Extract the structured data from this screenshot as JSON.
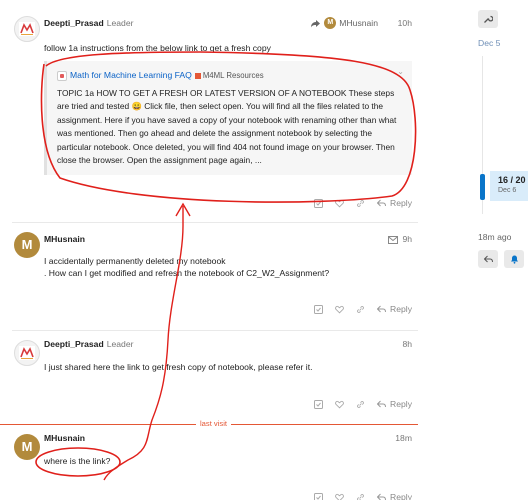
{
  "posts": [
    {
      "username": "Deepti_Prasad",
      "flair": "Leader",
      "reply_to_user": "MHusnain",
      "time": "10h",
      "body": "follow 1a instructions from the below link to get a fresh copy",
      "onebox": {
        "title": "Math for Machine Learning FAQ",
        "category": "M4ML Resources",
        "text": "TOPIC 1a HOW TO GET A FRESH OR LATEST VERSION OF A NOTEBOOK These steps are tried and tested 😀 Click file, then select open. You will find all the files related to the assignment. Here if you have saved a copy of your notebook with renaming other than what was mentioned. Then go ahead and delete the assignment notebook by selecting the particular notebook. Once deleted, you will find 404 not found image on your browser. Then close the browser. Open the assignment page again, ..."
      },
      "reply_label": "Reply"
    },
    {
      "username": "MHusnain",
      "avatar_letter": "M",
      "time": "9h",
      "body_line1": "I accidentally permanently deleted my notebook",
      "body_line2": ". How can I get modified and refresh the notebook of C2_W2_Assignment?",
      "reply_label": "Reply"
    },
    {
      "username": "Deepti_Prasad",
      "flair": "Leader",
      "time": "8h",
      "body": "I just shared here the link to get fresh copy of notebook, please refer it.",
      "reply_label": "Reply"
    },
    {
      "username": "MHusnain",
      "avatar_letter": "M",
      "time": "18m",
      "body": "where is the link?",
      "reply_label": "Reply"
    }
  ],
  "last_visit_label": "last visit",
  "timeline": {
    "start_date": "Dec 5",
    "position": "16 / 20",
    "position_date": "Dec 6",
    "last_activity": "18m ago"
  },
  "colors": {
    "accent": "#0a75c9",
    "annotation": "#e0201b",
    "last_visit": "#e45735",
    "avatar_m": "#b28a3c"
  },
  "icons": [
    "share-reply-icon",
    "bookmark-icon",
    "heart-icon",
    "link-icon",
    "reply-icon",
    "envelope-icon",
    "wrench-icon",
    "bell-icon",
    "chevron-down-icon"
  ]
}
